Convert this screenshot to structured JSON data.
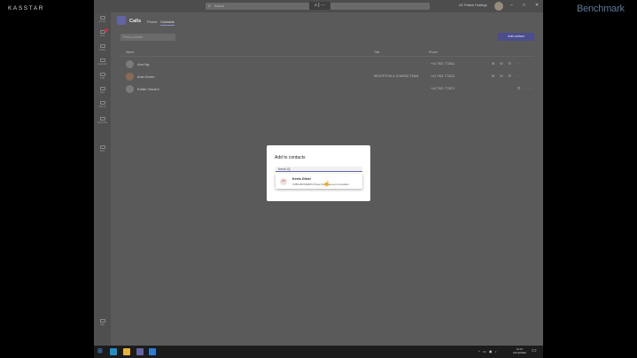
{
  "brand": {
    "left": "KASSTAR",
    "right": "Benchmark"
  },
  "titlebar": {
    "search_placeholder": "Search",
    "user_name": "UK Fintech Holdings"
  },
  "rail": {
    "items": [
      "Activity",
      "Chat",
      "Teams",
      "Calendar",
      "Calls",
      "Files",
      "Planner",
      "Approvals",
      "Apps",
      "Help"
    ]
  },
  "calls": {
    "title": "Calls",
    "tabs": [
      "Phone",
      "Contacts"
    ],
    "search_placeholder": "Find a contact",
    "add_contact_label": "Add contact",
    "columns": {
      "name": "Name",
      "title": "Title",
      "phone": "Phone"
    },
    "rows": [
      {
        "name": "Ann Ng",
        "title": "",
        "phone": "+44 7521 772811"
      },
      {
        "name": "Ana Green",
        "title": "RECEPTION & CHARGE TEAM",
        "phone": "+44 7521 772821"
      },
      {
        "name": "Eddie Vincent",
        "title": "",
        "phone": "+44 7521 772871"
      }
    ]
  },
  "modal": {
    "title": "Add to contacts",
    "input_value": "Kevin O|",
    "suggestion": {
      "initials": "KO",
      "name": "Kevin Oliver",
      "subtitle": "JOBS+BUSINESS Project Management Consultant"
    }
  },
  "taskbar": {
    "time": "14:07",
    "date": "16/12/2022"
  }
}
